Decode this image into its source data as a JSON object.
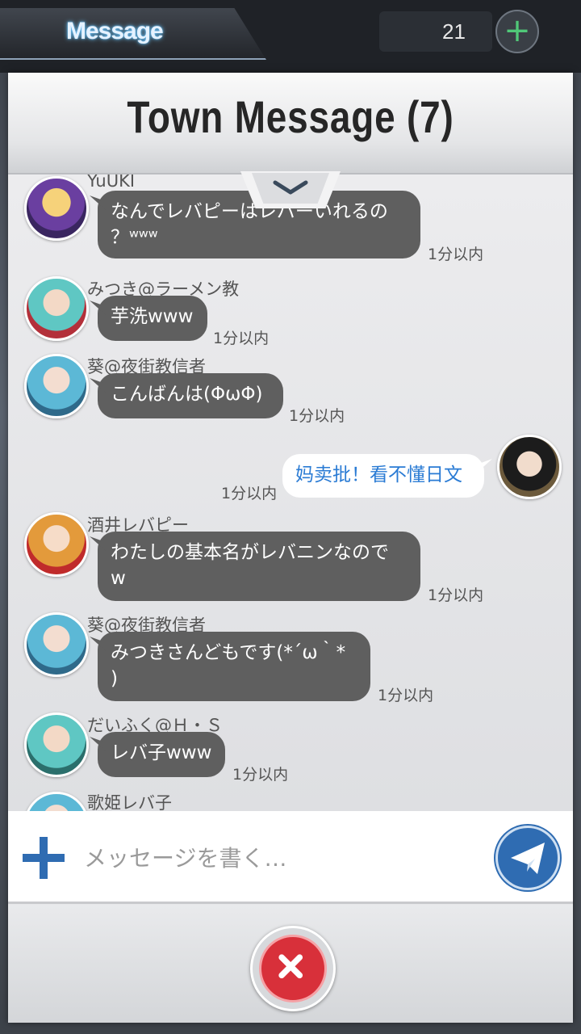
{
  "topbar": {
    "tab_label": "Message",
    "counter": "21"
  },
  "panel": {
    "title": "Town Message (7)"
  },
  "messages": [
    {
      "user": "YuUKI",
      "text1": "なんでレバピーはレバーいれるの",
      "text2": "？ʷʷʷ",
      "time": "1分以内"
    },
    {
      "user": "みつき@ラーメン教",
      "text1": "芋洗www",
      "time": "1分以内"
    },
    {
      "user": "葵@夜街教信者",
      "text1": "こんばんは(ΦωΦ)",
      "time": "1分以内"
    },
    {
      "self": true,
      "text1": "妈卖批！看不懂日文",
      "time": "1分以内"
    },
    {
      "user": "酒井レバピー",
      "text1": "わたしの基本名がレバニンなので",
      "text2": "w",
      "time": "1分以内"
    },
    {
      "user": "葵@夜街教信者",
      "text1": "みつきさんどもです(*´ω｀*",
      "text2": ")",
      "time": "1分以内"
    },
    {
      "user": "だいふく@Ｈ・Ｓ",
      "text1": "レバ子www",
      "time": "1分以内"
    },
    {
      "user": "歌姫レバ子"
    }
  ],
  "composer": {
    "placeholder": "メッセージを書く…"
  },
  "colors": {
    "accent": "#2f6cb2",
    "close": "#d8303a",
    "bubble": "#5f5f5f"
  }
}
